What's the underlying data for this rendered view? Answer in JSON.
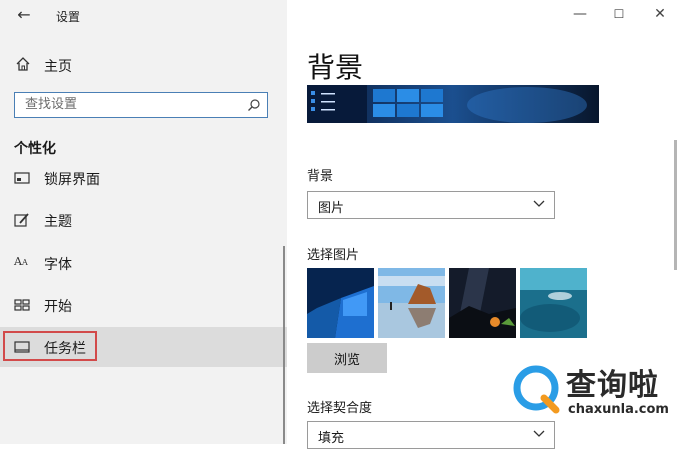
{
  "window": {
    "title": "设置",
    "back_icon": "back-arrow-icon",
    "controls": [
      "minimize",
      "maximize",
      "close"
    ]
  },
  "sidebar": {
    "home_label": "主页",
    "search_placeholder": "查找设置",
    "section_title": "个性化",
    "items": [
      {
        "label": "锁屏界面",
        "icon": "lock-screen-icon"
      },
      {
        "label": "主题",
        "icon": "theme-brush-icon"
      },
      {
        "label": "字体",
        "icon": "font-icon"
      },
      {
        "label": "开始",
        "icon": "start-menu-icon"
      },
      {
        "label": "任务栏",
        "icon": "taskbar-icon",
        "selected": true
      }
    ]
  },
  "main": {
    "page_title": "背景",
    "background_label": "背景",
    "background_value": "图片",
    "choose_picture_label": "选择图片",
    "browse_label": "浏览",
    "fit_label": "选择契合度",
    "fit_value": "填充"
  },
  "watermark": {
    "text": "查询啦",
    "sub": "chaxunla.com"
  },
  "colors": {
    "sidebar_bg": "#f2f2f2",
    "selected_bg": "#dcdcdc",
    "highlight_border": "#d24a4a",
    "search_border": "#4a7fb5",
    "watermark_blue": "#2a9de6",
    "watermark_orange": "#f39a1f"
  }
}
